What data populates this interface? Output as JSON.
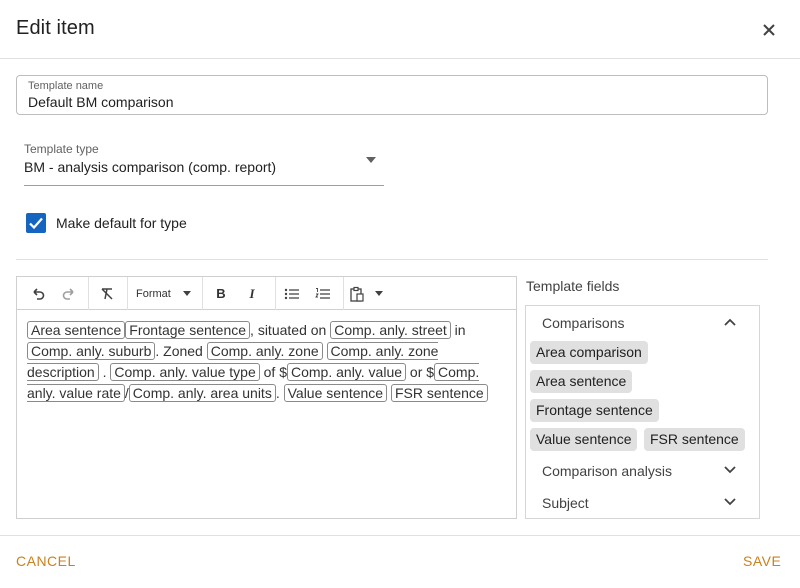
{
  "dialog": {
    "title": "Edit item"
  },
  "icons": {
    "close": "close-icon",
    "dropdown": "arrow-drop-down-icon",
    "check": "check-icon"
  },
  "colors": {
    "accent": "#c8821e",
    "checkbox": "#1565c0",
    "chip_bg": "#e0e0e0"
  },
  "template_name": {
    "label": "Template name",
    "value": "Default BM comparison"
  },
  "template_type": {
    "label": "Template type",
    "value": "BM - analysis comparison (comp. report)"
  },
  "make_default": {
    "label": "Make default for type",
    "checked": true
  },
  "toolbar": {
    "format_label": "Format"
  },
  "editor_content": {
    "area_sentence": "Area sentence",
    "frontage_sentence": "Frontage sentence",
    "t1": ", situated on ",
    "comp_street": "Comp. anly. street",
    "t2": " in ",
    "comp_suburb": "Comp. anly. suburb",
    "t3": ". Zoned ",
    "comp_zone": "Comp. anly. zone",
    "comp_zone_description": "Comp. anly. zone description",
    "t4": " . ",
    "comp_value_type": "Comp. anly. value type",
    "t5": " of $",
    "comp_value": "Comp. anly. value",
    "t6": " or $",
    "comp_value_rate": "Comp. anly. value rate",
    "t7": "/",
    "comp_area_units": "Comp. anly. area units",
    "t8": ". ",
    "value_sentence": "Value sentence",
    "fsr_sentence": "FSR sentence"
  },
  "template_fields": {
    "label": "Template fields",
    "groups": [
      {
        "title": "Comparisons",
        "expanded": true,
        "fields": [
          "Area comparison",
          "Area sentence",
          "Frontage sentence",
          "Value sentence",
          "FSR sentence"
        ]
      },
      {
        "title": "Comparison analysis",
        "expanded": false
      },
      {
        "title": "Subject",
        "expanded": false
      }
    ]
  },
  "footer": {
    "cancel": "CANCEL",
    "save": "SAVE"
  }
}
